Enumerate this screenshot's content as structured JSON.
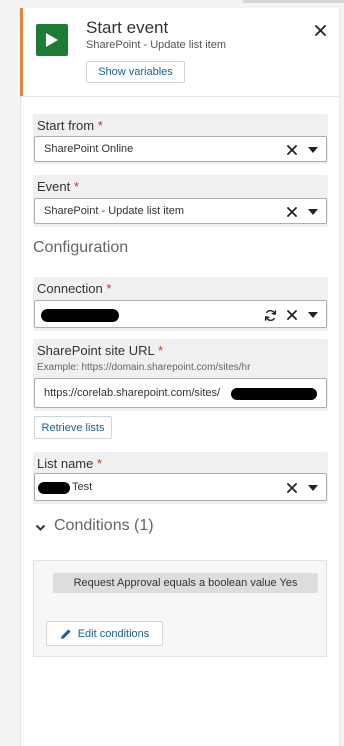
{
  "header": {
    "title": "Start event",
    "subtitle": "SharePoint - Update list item",
    "show_variables_label": "Show variables",
    "icon": "play-icon",
    "accent_color": "#e8803a",
    "icon_bg_color": "#1e7b34"
  },
  "start_from": {
    "label": "Start from",
    "required_mark": "*",
    "value": "SharePoint Online"
  },
  "event": {
    "label": "Event",
    "required_mark": "*",
    "value": "SharePoint - Update list item"
  },
  "configuration": {
    "heading": "Configuration"
  },
  "connection": {
    "label": "Connection",
    "required_mark": "*",
    "value_redacted": true
  },
  "site_url": {
    "label": "SharePoint site URL",
    "required_mark": "*",
    "hint": "Example: https://domain.sharepoint.com/sites/hr",
    "value": "https://corelab.sharepoint.com/sites/"
  },
  "retrieve_lists_label": "Retrieve lists",
  "list_name": {
    "label": "List name",
    "required_mark": "*",
    "value": "Test"
  },
  "conditions": {
    "heading": "Conditions (1)",
    "items": [
      "Request Approval equals a boolean value Yes"
    ],
    "edit_label": "Edit conditions"
  }
}
